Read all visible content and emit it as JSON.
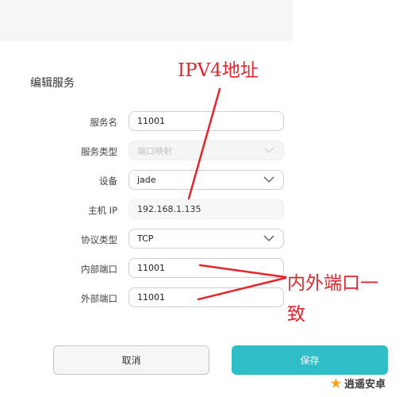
{
  "dialog": {
    "title": "编辑服务",
    "fields": [
      {
        "label": "服务名",
        "value": "11001"
      },
      {
        "label": "服务类型",
        "value": "端口映射"
      },
      {
        "label": "设备",
        "value": "jade"
      },
      {
        "label": "主机 IP",
        "value": "192.168.1.135"
      },
      {
        "label": "协议类型",
        "value": "TCP"
      },
      {
        "label": "内部端口",
        "value": "11001"
      },
      {
        "label": "外部端口",
        "value": "11001"
      }
    ],
    "cancel_label": "取消",
    "save_label": "保存"
  },
  "annotations": {
    "ip_note": "IPV4地址",
    "port_note_line1": "内外端口一",
    "port_note_line2": "致"
  },
  "watermark": {
    "text": "逍遥安卓",
    "icon": "star-icon"
  },
  "colors": {
    "accent": "#2fbdc8",
    "annotation": "#e8232a"
  }
}
